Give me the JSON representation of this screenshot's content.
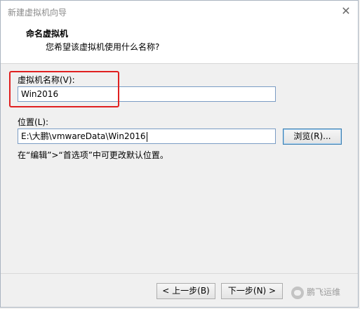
{
  "window": {
    "title": "新建虚拟机向导",
    "close_glyph": "✕"
  },
  "header": {
    "title": "命名虚拟机",
    "subtitle": "您希望该虚拟机使用什么名称?"
  },
  "vm_name": {
    "label": "虚拟机名称(V):",
    "value": "Win2016"
  },
  "location": {
    "label": "位置(L):",
    "value": "E:\\大鹏\\vmwareData\\Win2016",
    "browse_label": "浏览(R)...",
    "hint": "在“编辑”>“首选项”中可更改默认位置。"
  },
  "footer": {
    "back_label": "< 上一步(B)",
    "next_label": "下一步(N) >",
    "watermark_text": "鹏飞运维"
  },
  "colors": {
    "highlight": "#e02020",
    "input_border": "#7a9cc4"
  },
  "icons": {
    "close": "close-icon",
    "watermark": "wechat-logo-icon"
  }
}
